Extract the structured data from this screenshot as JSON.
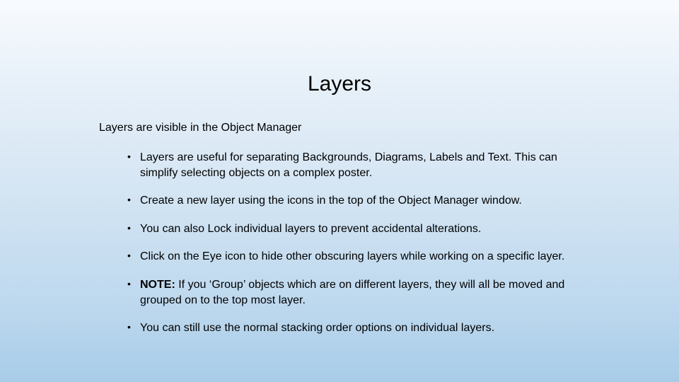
{
  "title": "Layers",
  "subtitle": "Layers are visible in the Object Manager",
  "bullets": {
    "b0": "Layers are useful for separating Backgrounds, Diagrams, Labels and Text. This can simplify selecting objects on a complex poster.",
    "b1": "Create a new layer using the icons in the top of the Object Manager window.",
    "b2": "You can also Lock individual layers to prevent accidental alterations.",
    "b3": "Click on the Eye icon to hide other obscuring layers while working on a specific layer.",
    "b4_prefix": "NOTE:",
    "b4_rest": " If you ‘Group’ objects which are on different layers, they will all be moved and grouped on to the top most layer.",
    "b5": "You can still use the normal stacking order options on individual layers."
  }
}
